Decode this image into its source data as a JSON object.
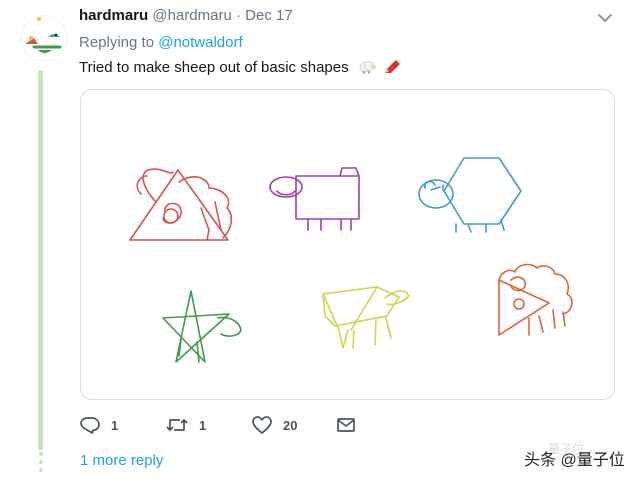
{
  "tweet": {
    "display_name": "hardmaru",
    "handle": "@hardmaru",
    "separator": "·",
    "date": "Dec 17",
    "replying_prefix": "Replying to ",
    "replying_handle": "@notwaldorf",
    "text": "Tried to make sheep out of basic shapes",
    "emojis": [
      "sheep-emoji",
      "crayon-emoji"
    ]
  },
  "actions": {
    "reply_count": "1",
    "retweet_count": "1",
    "like_count": "20"
  },
  "more_reply": "1 more reply",
  "watermark": "头条 @量子位",
  "watermark_ghost": "量子位",
  "colors": {
    "link": "#1da1f2",
    "thread_line": "#c7e3bf",
    "sheep_triangle": "#d9534f",
    "sheep_rectangle": "#9b3fb4",
    "sheep_hexagon": "#3d9bd6",
    "sheep_star": "#3f9a4a",
    "sheep_yellow": "#c8d84a",
    "sheep_orange": "#e0643a"
  },
  "icons": [
    "chevron-down-icon",
    "reply-icon",
    "retweet-icon",
    "like-icon",
    "message-icon"
  ]
}
